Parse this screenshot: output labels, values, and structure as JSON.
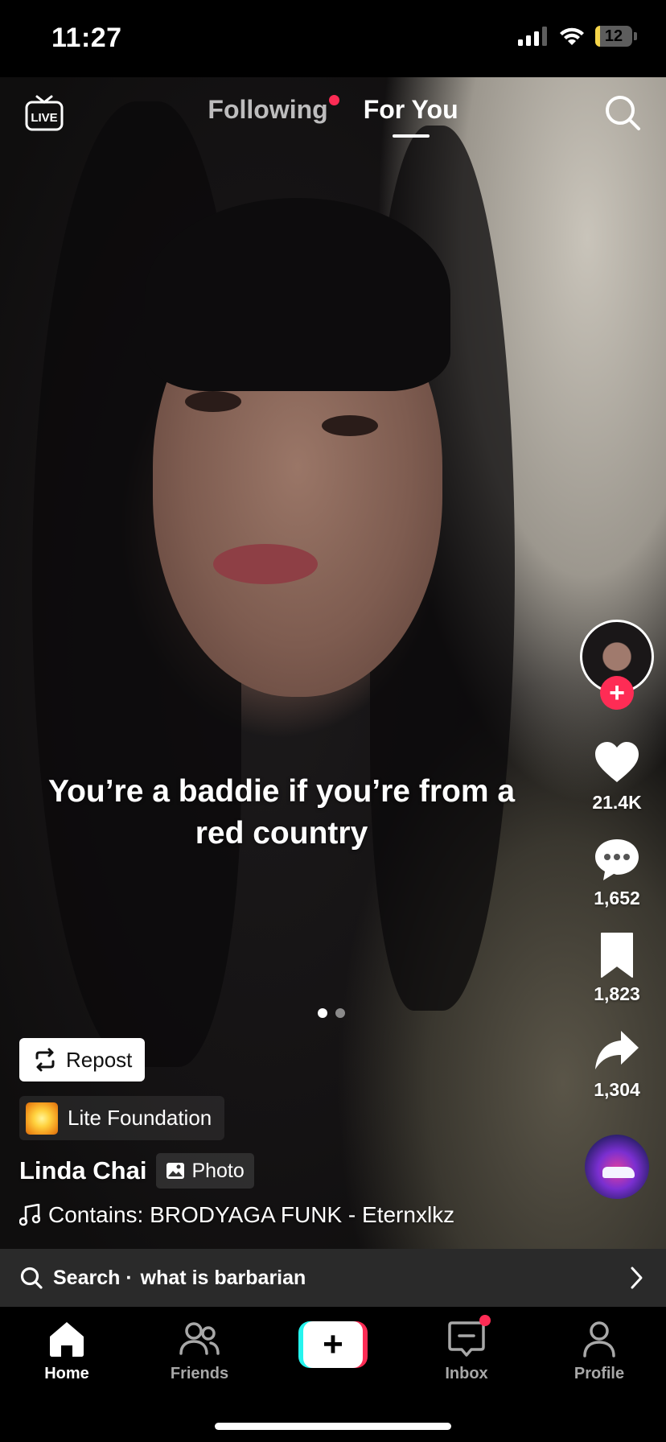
{
  "status_bar": {
    "time": "11:27",
    "battery_level": "12",
    "battery_fraction": 0.12,
    "icons": [
      "cellular-signal-icon",
      "wifi-icon",
      "battery-icon"
    ]
  },
  "top_nav": {
    "live_label": "LIVE",
    "tabs": [
      {
        "label": "Following",
        "active": false,
        "has_notification": true
      },
      {
        "label": "For You",
        "active": true
      }
    ]
  },
  "post": {
    "caption": "You’re a baddie if you’re from a red country",
    "slides_total": 2,
    "current_slide": 1
  },
  "actions": {
    "likes": "21.4K",
    "comments": "1,652",
    "saves": "1,823",
    "shares": "1,304"
  },
  "overlay": {
    "repost_label": "Repost",
    "effect_label": "Lite Foundation",
    "author": "Linda Chai",
    "media_type": "Photo",
    "music": "Contains: BRODYAGA FUNK - Eternxlkz"
  },
  "search_bar": {
    "prefix": "Search ·",
    "query": "what is barbarian"
  },
  "bottom_nav": {
    "items": [
      {
        "label": "Home",
        "active": true
      },
      {
        "label": "Friends",
        "active": false
      },
      {
        "label": "Inbox",
        "active": false,
        "has_notification": true
      },
      {
        "label": "Profile",
        "active": false
      }
    ],
    "create_label": "+"
  },
  "colors": {
    "accent_red": "#fe2c55",
    "accent_cyan": "#25f4ee",
    "battery_yellow": "#f6d54a"
  }
}
